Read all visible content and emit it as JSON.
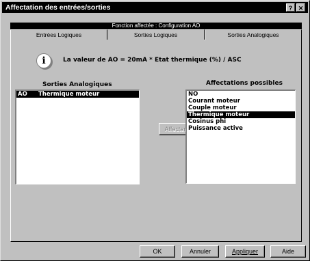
{
  "window": {
    "title": "Affectation des entrées/sorties",
    "help_button": "?",
    "close_button": "✕"
  },
  "header": {
    "function_label": "Fonction affectée : Configuration AO"
  },
  "tabs": [
    {
      "label": "Entrées Logiques",
      "active": false
    },
    {
      "label": "Sorties Logiques",
      "active": false
    },
    {
      "label": "Sorties Analogiques",
      "active": true
    }
  ],
  "info": {
    "icon": "info-icon",
    "text": "La valeur de AO = 20mA * Etat thermique (%) / ASC"
  },
  "outputs": {
    "title": "Sorties Analogiques",
    "items": [
      {
        "code": "AO",
        "name": "Thermique moteur",
        "selected": true
      }
    ]
  },
  "assign_button": "Affecter",
  "possible": {
    "title": "Affectations possibles",
    "items": [
      {
        "label": "NO",
        "selected": false
      },
      {
        "label": "Courant moteur",
        "selected": false
      },
      {
        "label": "Couple moteur",
        "selected": false
      },
      {
        "label": "Thermique moteur",
        "selected": true
      },
      {
        "label": "Cosinus phi",
        "selected": false
      },
      {
        "label": "Puissance active",
        "selected": false
      }
    ]
  },
  "footer": {
    "ok": "OK",
    "cancel": "Annuler",
    "apply": "Appliquer",
    "help": "Aide"
  },
  "colors": {
    "face": "#c0c0c0",
    "selection": "#000000"
  }
}
